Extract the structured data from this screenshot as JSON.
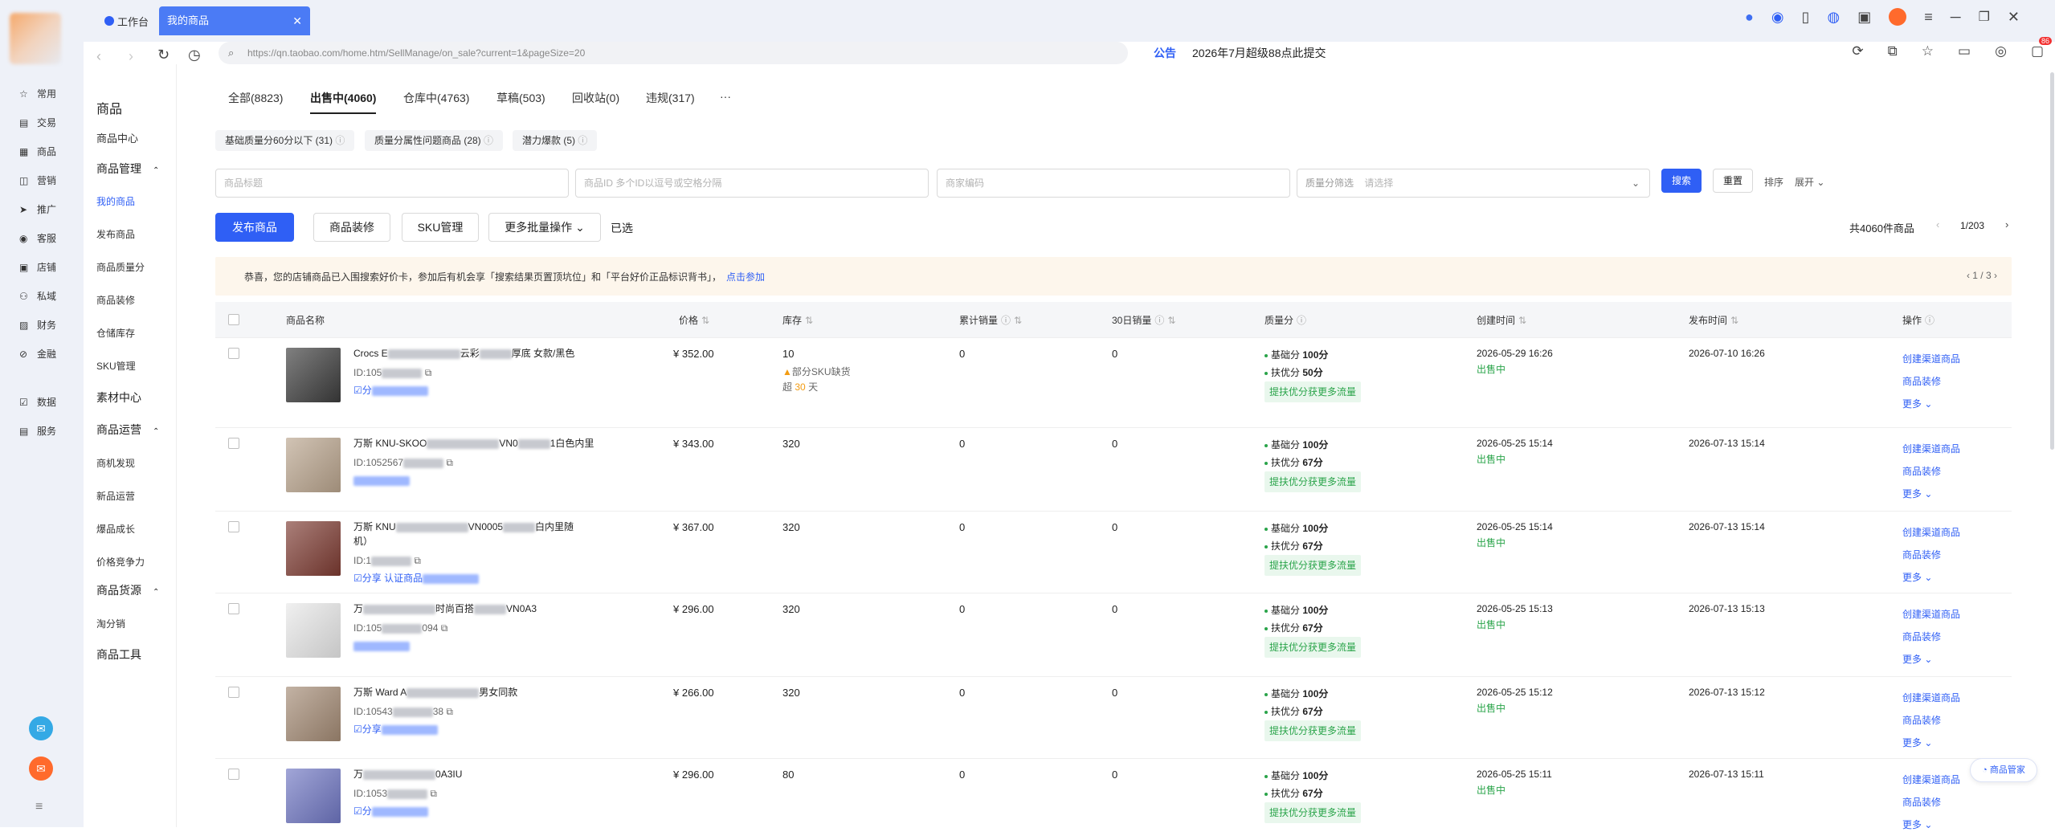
{
  "browser": {
    "tabs": [
      {
        "label": "工作台"
      },
      {
        "label": "我的商品"
      }
    ],
    "url": "https://qn.taobao.com/home.htm/SellManage/on_sale?current=1&pageSize=20",
    "notice_label": "公告",
    "notice_text": "2026年7月超级88点此提交",
    "notify_badge": "86"
  },
  "leftnav": [
    {
      "label": "常用"
    },
    {
      "label": "交易"
    },
    {
      "label": "商品"
    },
    {
      "label": "营销"
    },
    {
      "label": "推广"
    },
    {
      "label": "客服"
    },
    {
      "label": "店铺"
    },
    {
      "label": "私域"
    },
    {
      "label": "财务"
    },
    {
      "label": "金融"
    },
    {
      "label": "数据"
    },
    {
      "label": "服务"
    }
  ],
  "subnav": {
    "title": "商品",
    "center": "商品中心",
    "group1": "商品管理",
    "group1_items": [
      "我的商品",
      "发布商品",
      "商品质量分",
      "商品装修",
      "仓储库存",
      "SKU管理"
    ],
    "material": "素材中心",
    "group2": "商品运营",
    "group2_items": [
      "商机发现",
      "新品运营",
      "爆品成长",
      "价格竞争力"
    ],
    "group3": "商品货源",
    "group3_items": [
      "淘分销"
    ],
    "tools": "商品工具"
  },
  "status_tabs": [
    "全部(8823)",
    "出售中(4060)",
    "仓库中(4763)",
    "草稿(503)",
    "回收站(0)",
    "违规(317)",
    "···"
  ],
  "chips": [
    "基础质量分60分以下 (31)",
    "质量分属性问题商品 (28)",
    "潜力爆款 (5)"
  ],
  "filters": {
    "title_ph": "商品标题",
    "id_ph": "商品ID  多个ID以逗号或空格分隔",
    "code_ph": "商家编码",
    "quality_label": "质量分筛选",
    "quality_ph": "请选择",
    "search": "搜索",
    "reset": "重置",
    "sort": "排序",
    "expand": "展开"
  },
  "actions": {
    "publish": "发布商品",
    "decorate": "商品装修",
    "sku": "SKU管理",
    "batch": "更多批量操作",
    "selected": "已选",
    "total": "共4060件商品",
    "page": "1/203"
  },
  "banner": {
    "text": "恭喜，您的店铺商品已入围搜索好价卡，参加后有机会享「搜索结果页置顶坑位」和「平台好价正品标识背书」，",
    "link": "点击参加",
    "pager": "1 / 3"
  },
  "table": {
    "headers": [
      "商品名称",
      "价格",
      "库存",
      "累计销量",
      "30日销量",
      "质量分",
      "创建时间",
      "发布时间",
      "操作"
    ],
    "basic_label": "基础分",
    "support_label": "扶优分",
    "boost_tag": "提扶优分获更多流量",
    "status": "出售中",
    "ops": [
      "创建渠道商品",
      "商品装修",
      "更多"
    ],
    "rows": [
      {
        "title": "Crocs E",
        "title2": "云彩",
        "title3": "厚底 女款/黑色",
        "id": "ID:105",
        "share": "☑分",
        "price": "¥ 352.00",
        "stock": "10",
        "stock_warn": "部分SKU缺货",
        "stock_warn2": "超",
        "stock_days": "30",
        "stock_warn3": "天",
        "sales": "0",
        "sales30": "0",
        "basic": "100分",
        "support": "50分",
        "created": "2026-05-29 16:26",
        "published": "2026-07-10 16:26",
        "thumb": "#3c3c3c"
      },
      {
        "title": "万斯 KNU-SKOO",
        "title2": "VN0",
        "title3": "1白色内里",
        "id": "ID:1052567",
        "share": "",
        "price": "¥ 343.00",
        "stock": "320",
        "sales": "0",
        "sales30": "0",
        "basic": "100分",
        "support": "67分",
        "created": "2026-05-25 15:14",
        "published": "2026-07-13 15:14",
        "thumb": "#b9a48d"
      },
      {
        "title": "万斯 KNU",
        "title2": "VN0005",
        "title3": "白内里随",
        "title4": "机）",
        "id": "ID:1",
        "share": "☑分享",
        "share2": "认证商品",
        "price": "¥ 367.00",
        "stock": "320",
        "sales": "0",
        "sales30": "0",
        "basic": "100分",
        "support": "67分",
        "created": "2026-05-25 15:14",
        "published": "2026-07-13 15:14",
        "thumb": "#7d3b32"
      },
      {
        "title": "万",
        "title2": "时尚百搭",
        "title3": "VN0A3",
        "id": "ID:105",
        "id2": "094",
        "share": "",
        "price": "¥ 296.00",
        "stock": "320",
        "sales": "0",
        "sales30": "0",
        "basic": "100分",
        "support": "67分",
        "created": "2026-05-25 15:13",
        "published": "2026-07-13 15:13",
        "thumb": "#e8e8e8"
      },
      {
        "title": "万斯 Ward A",
        "title2": "男女同款",
        "id": "ID:10543",
        "id2": "38",
        "share": "☑分享",
        "price": "¥ 266.00",
        "stock": "320",
        "sales": "0",
        "sales30": "0",
        "basic": "100分",
        "support": "67分",
        "created": "2026-05-25 15:12",
        "published": "2026-07-13 15:12",
        "thumb": "#a38a74"
      },
      {
        "title": "万",
        "title2": "0A3IU",
        "id": "ID:1053",
        "share": "☑分",
        "price": "¥ 296.00",
        "stock": "80",
        "sales": "0",
        "sales30": "0",
        "basic": "100分",
        "support": "67分",
        "created": "2026-05-25 15:11",
        "published": "2026-07-13 15:11",
        "thumb": "#6f76c2"
      }
    ]
  },
  "float_button": "商品管家",
  "colors": {
    "primary": "#2f5ff5",
    "success": "#2aa44a",
    "warning": "#f39c12",
    "banner": "#fdf6ec"
  }
}
